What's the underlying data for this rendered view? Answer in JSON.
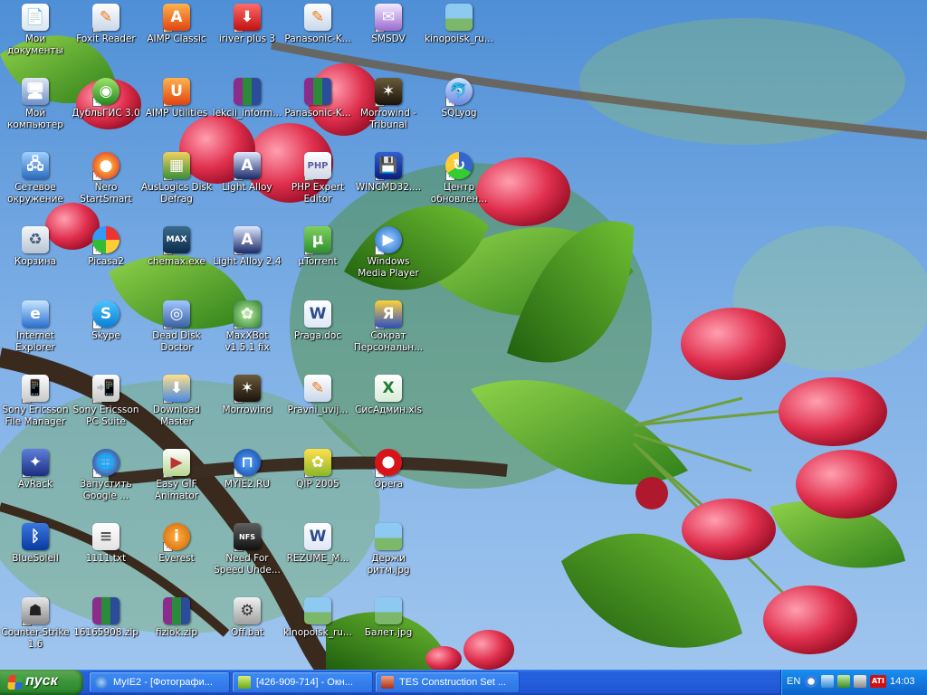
{
  "desktop": {
    "icons": [
      {
        "name": "moi-dokumenty",
        "label": "Мои документы",
        "icon": "documents-icon",
        "style": "ic-doc",
        "glyph": "📄",
        "arrow": false
      },
      {
        "name": "moi-kompyuter",
        "label": "Мой компьютер",
        "icon": "computer-icon",
        "style": "ic-pc",
        "glyph": "🖥",
        "arrow": false
      },
      {
        "name": "setevoe-okruzhenie",
        "label": "Сетевое окружение",
        "icon": "network-icon",
        "style": "ic-net",
        "glyph": "🖧",
        "arrow": false
      },
      {
        "name": "korzina",
        "label": "Корзина",
        "icon": "recycle-bin-icon",
        "style": "ic-bin",
        "glyph": "♻",
        "arrow": false
      },
      {
        "name": "internet-explorer",
        "label": "Internet Explorer",
        "icon": "internet-explorer-icon",
        "style": "ic-ie",
        "glyph": "e",
        "arrow": false
      },
      {
        "name": "sony-ericsson-file-manager",
        "label": "Sony Ericsson File Manager",
        "icon": "phone-icon",
        "style": "ic-sony",
        "glyph": "📱",
        "arrow": true
      },
      {
        "name": "avrack",
        "label": "AvRack",
        "icon": "avrack-icon",
        "style": "ic-avrack",
        "glyph": "✦",
        "arrow": true
      },
      {
        "name": "bluesoleil",
        "label": "BlueSoleil",
        "icon": "bluetooth-icon",
        "style": "ic-bt",
        "glyph": "ᛒ",
        "arrow": false
      },
      {
        "name": "counter-strike",
        "label": "Counter-Strike 1.6",
        "icon": "counter-strike-icon",
        "style": "ic-cs",
        "glyph": "☗",
        "arrow": true
      },
      {
        "name": "foxit-reader",
        "label": "Foxit Reader",
        "icon": "foxit-reader-icon",
        "style": "ic-foxit",
        "glyph": "✎",
        "arrow": true
      },
      {
        "name": "dublgis",
        "label": "ДубльГИС 3.0",
        "icon": "dublgis-icon",
        "style": "ic-dgis",
        "glyph": "◉",
        "arrow": true
      },
      {
        "name": "nero-startsmart",
        "label": "Nero StartSmart",
        "icon": "nero-icon",
        "style": "ic-nero",
        "glyph": "●",
        "arrow": true
      },
      {
        "name": "picasa2",
        "label": "Picasa2",
        "icon": "picasa-icon",
        "style": "ic-picasa",
        "glyph": "",
        "arrow": true
      },
      {
        "name": "skype",
        "label": "Skype",
        "icon": "skype-icon",
        "style": "ic-skype",
        "glyph": "S",
        "arrow": true
      },
      {
        "name": "sony-ericsson-pc-suite",
        "label": "Sony Ericsson PC Suite",
        "icon": "pc-suite-icon",
        "style": "ic-sony",
        "glyph": "📲",
        "arrow": true
      },
      {
        "name": "zapustit-google",
        "label": "Запустить Google ...",
        "icon": "google-earth-icon",
        "style": "ic-google",
        "glyph": "🌐",
        "arrow": true
      },
      {
        "name": "1111-txt",
        "label": "1111.txt",
        "icon": "text-file-icon",
        "style": "ic-txt",
        "glyph": "≡",
        "arrow": false
      },
      {
        "name": "16165908-zip",
        "label": "16165908.zip",
        "icon": "zip-archive-icon",
        "style": "ic-zip",
        "glyph": "",
        "arrow": false
      },
      {
        "name": "aimp-classic",
        "label": "AIMP Classic",
        "icon": "aimp-icon",
        "style": "ic-aimp",
        "glyph": "A",
        "arrow": true
      },
      {
        "name": "aimp-utilities",
        "label": "AIMP Utilities",
        "icon": "aimp-utilities-icon",
        "style": "ic-aimp",
        "glyph": "U",
        "arrow": true
      },
      {
        "name": "auslogics-disk-defrag",
        "label": "AusLogics Disk Defrag",
        "icon": "defrag-icon",
        "style": "ic-auslog",
        "glyph": "▦",
        "arrow": true
      },
      {
        "name": "chemax-exe",
        "label": "chemax.exe",
        "icon": "chemax-icon",
        "style": "ic-chemax",
        "glyph": "MAX",
        "arrow": true
      },
      {
        "name": "dead-disk-doctor",
        "label": "Dead Disk Doctor",
        "icon": "disk-doctor-icon",
        "style": "ic-disk",
        "glyph": "◎",
        "arrow": true
      },
      {
        "name": "download-master",
        "label": "Download Master",
        "icon": "download-master-icon",
        "style": "ic-dlm",
        "glyph": "⬇",
        "arrow": true
      },
      {
        "name": "easy-gif-animator",
        "label": "Easy GIF Animator",
        "icon": "gif-animator-icon",
        "style": "ic-gif",
        "glyph": "▶",
        "arrow": true
      },
      {
        "name": "everest",
        "label": "Everest",
        "icon": "everest-icon",
        "style": "ic-info",
        "glyph": "i",
        "arrow": true
      },
      {
        "name": "fiziok-zip",
        "label": "fiziok.zip",
        "icon": "zip-archive-icon",
        "style": "ic-zip",
        "glyph": "",
        "arrow": false
      },
      {
        "name": "iriver-plus-3",
        "label": "iriver plus 3",
        "icon": "iriver-icon",
        "style": "ic-iriver",
        "glyph": "⬇",
        "arrow": true
      },
      {
        "name": "lekcii-inform",
        "label": "lekcii_inform...",
        "icon": "rar-archive-icon",
        "style": "ic-zip",
        "glyph": "",
        "arrow": false
      },
      {
        "name": "light-alloy",
        "label": "Light Alloy",
        "icon": "light-alloy-icon",
        "style": "ic-light",
        "glyph": "A",
        "arrow": true
      },
      {
        "name": "light-alloy-2-4",
        "label": "Light Alloy 2.4",
        "icon": "light-alloy-icon",
        "style": "ic-light",
        "glyph": "A",
        "arrow": true
      },
      {
        "name": "maxxbot",
        "label": "MaxXBot v1.5.1 fix",
        "icon": "maxxbot-icon",
        "style": "ic-maxx",
        "glyph": "✿",
        "arrow": true
      },
      {
        "name": "morrowind",
        "label": "Morrowind",
        "icon": "morrowind-icon",
        "style": "ic-morr",
        "glyph": "✶",
        "arrow": true
      },
      {
        "name": "myie2-ru",
        "label": "MYIE2.RU",
        "icon": "myie2-icon",
        "style": "ic-myie",
        "glyph": "⊓",
        "arrow": true
      },
      {
        "name": "need-for-speed",
        "label": "Need For Speed Unde...",
        "icon": "nfs-icon",
        "style": "ic-nfs",
        "glyph": "NFS",
        "arrow": true
      },
      {
        "name": "off-bat",
        "label": "Off.bat",
        "icon": "batch-file-icon",
        "style": "ic-bat",
        "glyph": "⚙",
        "arrow": false
      },
      {
        "name": "panasonic-k-1",
        "label": "Panasonic-K...",
        "icon": "pdf-document-icon",
        "style": "ic-pana",
        "glyph": "✎",
        "arrow": false
      },
      {
        "name": "panasonic-k-2",
        "label": "Panasonic-K...",
        "icon": "rar-archive-icon",
        "style": "ic-zip",
        "glyph": "",
        "arrow": false
      },
      {
        "name": "php-expert-editor",
        "label": "PHP Expert Editor",
        "icon": "php-editor-icon",
        "style": "ic-php",
        "glyph": "PHP",
        "arrow": true
      },
      {
        "name": "utorrent",
        "label": "µTorrent",
        "icon": "utorrent-icon",
        "style": "ic-utor",
        "glyph": "µ",
        "arrow": true
      },
      {
        "name": "praga-doc",
        "label": "Praga.doc",
        "icon": "word-document-icon",
        "style": "ic-word",
        "glyph": "W",
        "arrow": false
      },
      {
        "name": "pravni-uvij",
        "label": "Pravni_uvij...",
        "icon": "pdf-document-icon",
        "style": "ic-pana",
        "glyph": "✎",
        "arrow": false
      },
      {
        "name": "qip-2005",
        "label": "QIP 2005",
        "icon": "qip-icon",
        "style": "ic-qip",
        "glyph": "✿",
        "arrow": true
      },
      {
        "name": "rezume-m",
        "label": "REZUME_M...",
        "icon": "word-document-icon",
        "style": "ic-word",
        "glyph": "W",
        "arrow": false
      },
      {
        "name": "kinopoisk-ru-2",
        "label": "kinopoisk_ru...",
        "icon": "image-file-icon",
        "style": "ic-img",
        "glyph": "",
        "arrow": false
      },
      {
        "name": "smsdv",
        "label": "SMSDV",
        "icon": "smsdv-icon",
        "style": "ic-smsdv",
        "glyph": "✉",
        "arrow": true
      },
      {
        "name": "morrowind-tribunal",
        "label": "Morrowind - Tribunal",
        "icon": "morrowind-icon",
        "style": "ic-morr",
        "glyph": "✶",
        "arrow": true
      },
      {
        "name": "wincmd32",
        "label": "WINCMD32....",
        "icon": "total-commander-icon",
        "style": "ic-wincmd",
        "glyph": "💾",
        "arrow": true
      },
      {
        "name": "windows-media-player",
        "label": "Windows Media Player",
        "icon": "media-player-icon",
        "style": "ic-wmp",
        "glyph": "▶",
        "arrow": true
      },
      {
        "name": "sokrat",
        "label": "Сократ Персональн...",
        "icon": "sokrat-icon",
        "style": "ic-sokrat",
        "glyph": "Я",
        "arrow": true
      },
      {
        "name": "sisadmin-xls",
        "label": "СисАдмин.xls",
        "icon": "excel-document-icon",
        "style": "ic-xls",
        "glyph": "X",
        "arrow": false
      },
      {
        "name": "opera",
        "label": "Opera",
        "icon": "opera-icon",
        "style": "ic-opera",
        "glyph": "",
        "arrow": true
      },
      {
        "name": "derzhi-ritm-jpg",
        "label": "Держи ритм.jpg",
        "icon": "image-file-icon",
        "style": "ic-img",
        "glyph": "",
        "arrow": false
      },
      {
        "name": "balet-jpg",
        "label": "Балет.jpg",
        "icon": "image-file-icon",
        "style": "ic-img",
        "glyph": "",
        "arrow": false
      },
      {
        "name": "kinopoisk-ru-1",
        "label": "kinopoisk_ru...",
        "icon": "image-file-icon",
        "style": "ic-img",
        "glyph": "",
        "arrow": false
      },
      {
        "name": "sqlyog",
        "label": "SQLyog",
        "icon": "sqlyog-icon",
        "style": "ic-sqlyog",
        "glyph": "🐬",
        "arrow": true
      },
      {
        "name": "centr-obnovleniy",
        "label": "Центр обновлен...",
        "icon": "update-center-icon",
        "style": "ic-update",
        "glyph": "↻",
        "arrow": true
      }
    ]
  },
  "taskbar": {
    "start_label": "пуск",
    "buttons": [
      {
        "name": "task-myie2",
        "title": "MyIE2 - [Фотографи...",
        "icon": "myie2-icon",
        "color": "#2a7fff"
      },
      {
        "name": "task-icq",
        "title": "[426-909-714] - Окн...",
        "icon": "chat-window-icon",
        "color": "#9ccc3a"
      },
      {
        "name": "task-tes",
        "title": "TES Construction Set ...",
        "icon": "construction-set-icon",
        "color": "#c8461e"
      }
    ],
    "tray": {
      "language": "EN",
      "icons": [
        "arrow-left-icon",
        "network-icon",
        "hardware-icon",
        "volume-icon",
        "ati-icon"
      ],
      "clock": "14:03"
    }
  }
}
